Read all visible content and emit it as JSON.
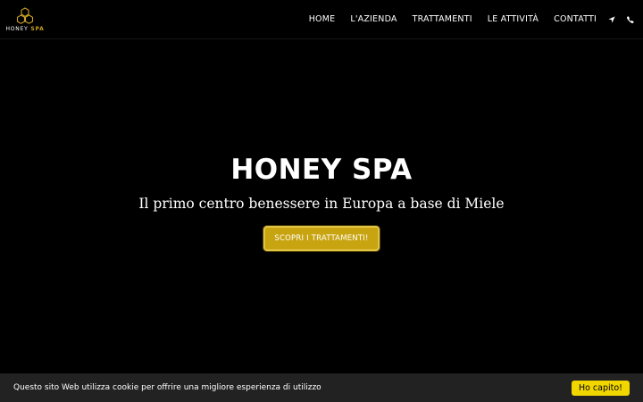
{
  "brand": {
    "logo_icon": "honeycomb-logo-icon",
    "name_main": "HONEY ",
    "name_accent": "SPA",
    "accent_color": "#c9a227"
  },
  "nav": {
    "items": [
      {
        "label": "HOME"
      },
      {
        "label": "L'AZIENDA"
      },
      {
        "label": "TRATTAMENTI"
      },
      {
        "label": "LE ATTIVITÀ"
      },
      {
        "label": "CONTATTI"
      }
    ],
    "icons": [
      "location-arrow-icon",
      "phone-icon"
    ]
  },
  "hero": {
    "title": "HONEY SPA",
    "subtitle": "Il primo centro benessere in Europa a base di Miele",
    "button_label": "SCOPRI I TRATTAMENTI!",
    "button_color": "#c8a411"
  },
  "cookie": {
    "text": "Questo sito Web utilizza cookie per offrire una migliore esperienza di utilizzo",
    "button_label": "Ho capito!",
    "button_color": "#f1d600"
  }
}
